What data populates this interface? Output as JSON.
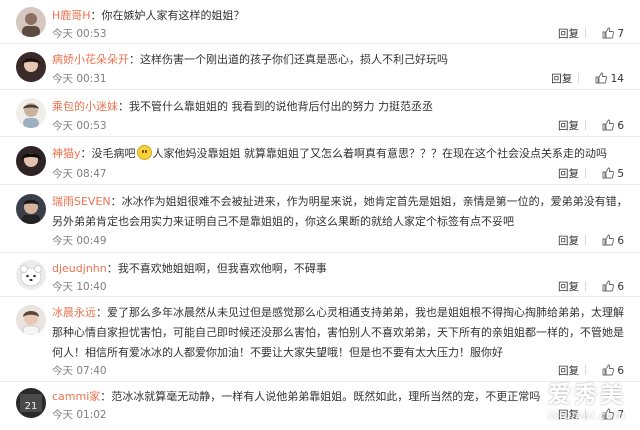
{
  "colors": {
    "username": "#eb7350",
    "time": "#808080",
    "divider": "#ececec"
  },
  "actions": {
    "reply_label": "回复",
    "like_icon": "thumbs-up-icon"
  },
  "comments": [
    {
      "username": "H鹿哥H",
      "text": "你在嫉妒人家有这样的姐姐？",
      "time": "今天 00:53",
      "likes": "7"
    },
    {
      "username": "病娇小花朵朵开",
      "text": "这样伤害一个刚出道的孩子你们还真是恶心，损人不利己好玩吗",
      "time": "今天 00:31",
      "likes": "14"
    },
    {
      "username": "乘包的小迷妹",
      "text": "我不管什么靠姐姐的 我看到的说他背后付出的努力 力挺范丞丞",
      "time": "今天 00:53",
      "likes": "6"
    },
    {
      "username": "神猫y",
      "text_before": "没毛病吧",
      "text_after": "人家他妈没靠姐姐 就算靠姐姐了又怎么着啊真有意思？？？在现在这个社会没点关系走的动吗",
      "emoji_icon": "smile-emoji-icon",
      "time": "今天 08:47",
      "likes": "5"
    },
    {
      "username": "瑞雨SEVEN",
      "text": "冰冰作为姐姐很难不会被扯进来，作为明星来说，她肯定首先是姐姐，亲情是第一位的，爱弟弟没有错，另外弟弟肯定也会用实力来证明自己不是靠姐姐的，你这么果断的就给人家定个标签有点不妥吧",
      "time": "今天 00:49",
      "likes": "6"
    },
    {
      "username": "djeudjnhn",
      "text": "我不喜欢她姐姐啊，但我喜欢他啊，不碍事",
      "time": "今天 10:40",
      "likes": "6"
    },
    {
      "username": "冰晨永远",
      "text": "爱了那么多年冰晨然从未见过但是感觉那么心灵相通支持弟弟，我也是姐姐根不得掏心掏肺给弟弟，太理解那种心情自家担忧害怕，可能自己即时候还没那么害怕，害怕别人不喜欢弟弟，天下所有的亲姐姐都一样的，不管她是何人！相信所有爱冰冰的人都爱你加油！不要让大家失望哦！但是也不要有太大压力！服你好",
      "time": "今天 07:40",
      "likes": "6"
    },
    {
      "username": "cammi家",
      "text": "范冰冰就算毫无动静，一样有人说他弟弟靠姐姐。既然如此，理所当然的宠，不更正常吗",
      "time": "今天 01:02",
      "likes": "7"
    }
  ],
  "watermark": {
    "main": "爱秀美",
    "sub": "ixiumei.com"
  }
}
